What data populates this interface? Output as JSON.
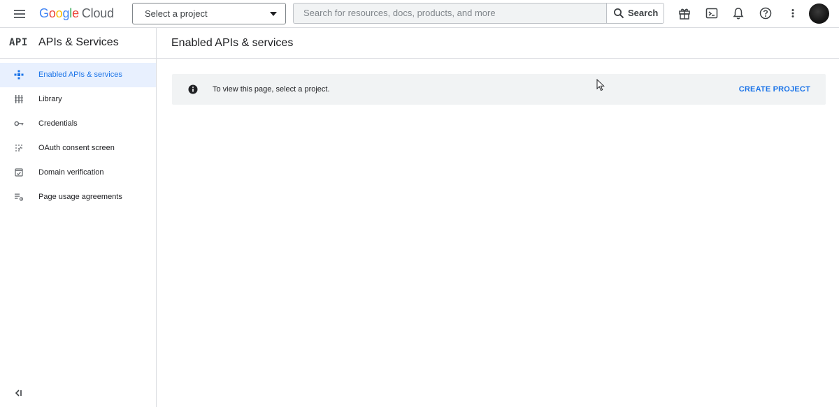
{
  "topbar": {
    "logo_google": "Google",
    "logo_cloud": "Cloud",
    "project_selector": "Select a project",
    "search_placeholder": "Search for resources, docs, products, and more",
    "search_button": "Search",
    "icons": [
      "menu-icon",
      "gift-icon",
      "cloud-shell-icon",
      "notifications-icon",
      "help-icon",
      "more-vert-icon"
    ]
  },
  "sidebar": {
    "badge": "API",
    "title": "APIs & Services",
    "items": [
      {
        "label": "Enabled APIs & services",
        "icon": "enabled-apis-icon",
        "active": true
      },
      {
        "label": "Library",
        "icon": "library-icon",
        "active": false
      },
      {
        "label": "Credentials",
        "icon": "key-icon",
        "active": false
      },
      {
        "label": "OAuth consent screen",
        "icon": "oauth-icon",
        "active": false
      },
      {
        "label": "Domain verification",
        "icon": "domain-verification-icon",
        "active": false
      },
      {
        "label": "Page usage agreements",
        "icon": "page-usage-icon",
        "active": false
      }
    ],
    "collapse_icon": "collapse-sidebar-icon"
  },
  "main": {
    "page_title": "Enabled APIs & services",
    "banner": {
      "message": "To view this page, select a project.",
      "action": "CREATE PROJECT"
    }
  },
  "colors": {
    "accent": "#1a73e8",
    "active_bg": "#e8f0fe",
    "banner_bg": "#f1f3f4",
    "divider": "#dadce0"
  }
}
